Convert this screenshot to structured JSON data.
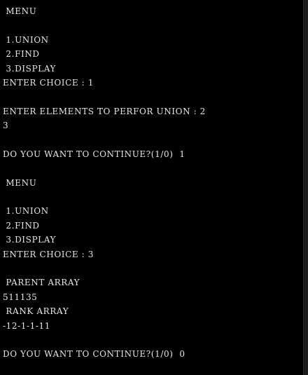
{
  "terminal": {
    "lines": [
      " MENU",
      "",
      " 1.UNION",
      " 2.FIND",
      " 3.DISPLAY",
      "ENTER CHOICE : 1",
      "",
      "ENTER ELEMENTS TO PERFOR UNION : 2",
      "3",
      "",
      "DO YOU WANT TO CONTINUE?(1/0)  1",
      "",
      " MENU",
      "",
      " 1.UNION",
      " 2.FIND",
      " 3.DISPLAY",
      "ENTER CHOICE : 3",
      "",
      " PARENT ARRAY",
      "511135",
      " RANK ARRAY",
      "-12-1-1-11",
      "",
      "DO YOU WANT TO CONTINUE?(1/0)  0"
    ]
  },
  "colors": {
    "background": "#000000",
    "text": "#e6e6e6"
  }
}
